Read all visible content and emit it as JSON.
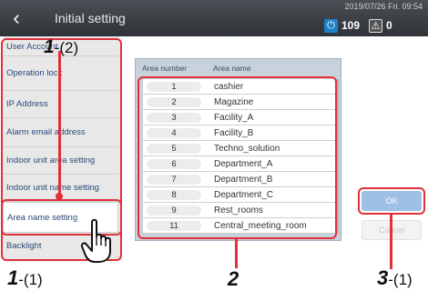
{
  "header": {
    "title": "Initial setting",
    "datetime": "2019/07/26 Fri. 09:54",
    "power_count": "109",
    "alarm_count": "0"
  },
  "sidebar": {
    "items": [
      {
        "label": "User Account"
      },
      {
        "label": "Operation lock"
      },
      {
        "label": "IP Address"
      },
      {
        "label": "Alarm email address"
      },
      {
        "label": "Indoor unit area setting"
      },
      {
        "label": "Indoor unit name setting"
      },
      {
        "label": "Area name setting"
      },
      {
        "label": "Backlight"
      }
    ],
    "active_index": 6
  },
  "table": {
    "headers": {
      "col1": "Area number",
      "col2": "Area name"
    },
    "rows": [
      {
        "number": "1",
        "name": "cashier"
      },
      {
        "number": "2",
        "name": "Magazine"
      },
      {
        "number": "3",
        "name": "Facility_A"
      },
      {
        "number": "4",
        "name": "Facility_B"
      },
      {
        "number": "5",
        "name": "Techno_solution"
      },
      {
        "number": "6",
        "name": "Department_A"
      },
      {
        "number": "7",
        "name": "Department_B"
      },
      {
        "number": "8",
        "name": "Department_C"
      },
      {
        "number": "9",
        "name": "Rest_rooms"
      },
      {
        "number": "11",
        "name": "Central_meeting_room"
      }
    ]
  },
  "buttons": {
    "ok": "OK",
    "cancel": "Cancel"
  },
  "callouts": {
    "c1_top_main": "1",
    "c1_top_sub": "-(2)",
    "c1_bottom_main": "1",
    "c1_bottom_sub": "-(1)",
    "c2": "2",
    "c3_main": "3",
    "c3_sub": "-(1)"
  },
  "colors": {
    "accent_red": "#e2303a",
    "header_bg": "#3a3f45",
    "ok_button": "#9fc0e6"
  }
}
